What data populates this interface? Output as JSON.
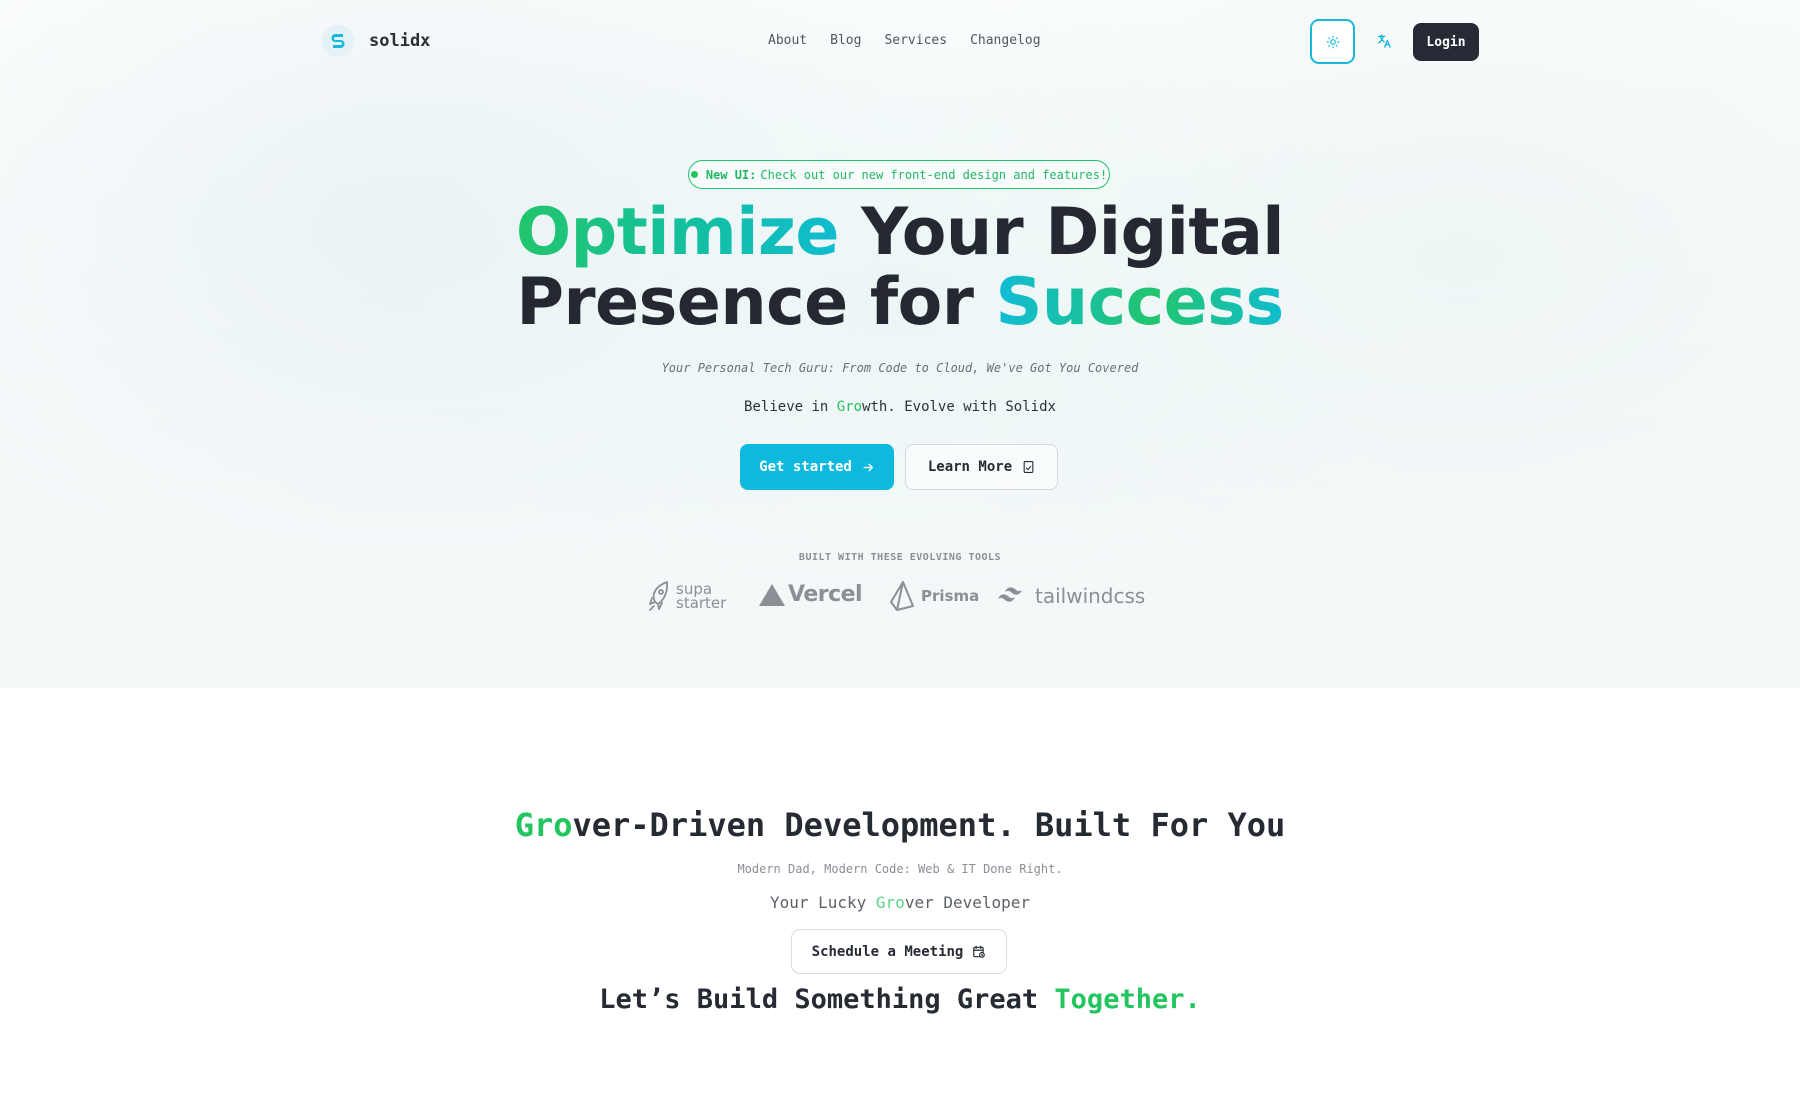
{
  "header": {
    "brand": "solidx",
    "nav": [
      {
        "label": "About"
      },
      {
        "label": "Blog"
      },
      {
        "label": "Services"
      },
      {
        "label": "Changelog"
      }
    ],
    "login_label": "Login"
  },
  "hero": {
    "badge": {
      "strong": "New UI:",
      "text": "Check out our new front-end design and features!"
    },
    "headline": {
      "accent1": "Optimize",
      "part1": " Your Digital",
      "part2": "Presence for ",
      "accent2": "Success"
    },
    "tagline": "Your Personal Tech Guru: From Code to Cloud, We've Got You Covered",
    "believe": {
      "pre": "Believe in ",
      "accent": "Gro",
      "post": "wth. Evolve with Solidx"
    },
    "primary_button": "Get started",
    "secondary_button": "Learn More",
    "tools_label": "BUILT WITH THESE EVOLVING TOOLS",
    "tools": [
      {
        "line1": "supa",
        "line2": "starter"
      },
      {
        "name": "Vercel"
      },
      {
        "name": "Prisma"
      },
      {
        "name": "tailwindcss"
      }
    ]
  },
  "section2": {
    "title": {
      "accent": "Gro",
      "rest": "ver-Driven Development. Built For You"
    },
    "subtitle": "Modern Dad, Modern Code: Web & IT Done Right.",
    "lucky": {
      "pre": "Your Lucky ",
      "accent": "Gro",
      "post": "ver Developer"
    },
    "meeting_button": "Schedule a Meeting",
    "closing": {
      "pre": "Let’s Build Something Great ",
      "accent": "Together."
    }
  },
  "colors": {
    "accent_green": "#22c55e",
    "accent_cyan": "#0fb8de",
    "dark": "#262a35"
  },
  "icons": [
    "sun-icon",
    "translate-icon",
    "arrow-right-icon",
    "book-icon",
    "calendar-icon",
    "rocket-icon",
    "vercel-triangle-icon",
    "prisma-icon",
    "tailwind-icon",
    "logo-icon"
  ]
}
